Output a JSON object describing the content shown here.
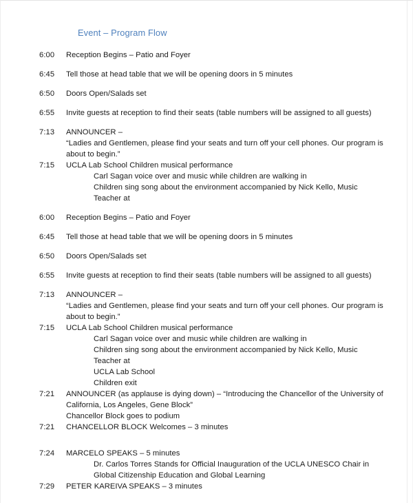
{
  "document": {
    "title": "Event – Program Flow",
    "title_color": "#4f81bd",
    "background_color": "#ffffff",
    "text_color": "#1a1a1a"
  },
  "program": {
    "rows": [
      {
        "time": "6:00",
        "text": "Reception Begins – Patio and Foyer",
        "spacing": "gap-after"
      },
      {
        "time": "6:45",
        "text": "Tell those at head table that we will be opening doors in 5 minutes",
        "spacing": "gap-after"
      },
      {
        "time": "6:50",
        "text": "Doors Open/Salads set",
        "spacing": "gap-after"
      },
      {
        "time": "6:55",
        "text": "Invite guests at reception to find their seats (table numbers will be assigned to all guests)",
        "spacing": "gap-after"
      },
      {
        "time": "7:13",
        "text": "ANNOUNCER –",
        "spacing": "tight"
      },
      {
        "time": "",
        "text": "“Ladies and Gentlemen, please find your seats and turn off your cell phones.  Our program is about to begin.”",
        "spacing": "tight"
      },
      {
        "time": "7:15",
        "text": "UCLA Lab School Children musical performance",
        "spacing": "tight"
      },
      {
        "time": "",
        "text": "Carl Sagan voice over and music while children are walking in",
        "spacing": "tight",
        "indent": true
      },
      {
        "time": "",
        "text": "Children sing song about the environment accompanied by Nick Kello, Music Teacher at",
        "spacing": "gap-after",
        "indent": true
      },
      {
        "time": "6:00",
        "text": "Reception Begins – Patio and Foyer",
        "spacing": "gap-after"
      },
      {
        "time": "6:45",
        "text": "Tell those at head table that we will be opening doors in 5 minutes",
        "spacing": "gap-after"
      },
      {
        "time": "6:50",
        "text": "Doors Open/Salads set",
        "spacing": "gap-after"
      },
      {
        "time": "6:55",
        "text": "Invite guests at reception to find their seats (table numbers will be assigned to all guests)",
        "spacing": "gap-after"
      },
      {
        "time": "7:13",
        "text": "ANNOUNCER –",
        "spacing": "tight"
      },
      {
        "time": "",
        "text": "“Ladies and Gentlemen, please find your seats and turn off your cell phones.  Our program is about to begin.”",
        "spacing": "tight"
      },
      {
        "time": "7:15",
        "text": "UCLA Lab School Children musical performance",
        "spacing": "tight"
      },
      {
        "time": "",
        "text": "Carl Sagan voice over and music while children are walking in",
        "spacing": "tight",
        "indent": true
      },
      {
        "time": "",
        "text": "Children sing song about the environment accompanied by Nick Kello, Music Teacher at",
        "spacing": "tight",
        "indent": true
      },
      {
        "time": "",
        "text": "UCLA Lab School",
        "spacing": "tight",
        "indent": true
      },
      {
        "time": "",
        "text": "Children exit",
        "spacing": "tight",
        "indent": true
      },
      {
        "time": "7:21",
        "text": "ANNOUNCER (as applause is dying down) – “Introducing the Chancellor of the University of California, Los Angeles, Gene Block”",
        "spacing": "tight"
      },
      {
        "time": "",
        "text": "Chancellor Block goes to podium",
        "spacing": "tight"
      },
      {
        "time": "7:21",
        "text": "CHANCELLOR BLOCK Welcomes – 3 minutes",
        "spacing": "gap-big"
      },
      {
        "time": "7:24",
        "text": "MARCELO SPEAKS – 5 minutes",
        "spacing": "tight"
      },
      {
        "time": "",
        "text": "Dr. Carlos Torres Stands for Official Inauguration of the UCLA UNESCO Chair in Global Citizenship Education and Global Learning",
        "spacing": "tight",
        "indent": true
      },
      {
        "time": "7:29",
        "text": "PETER KAREIVA SPEAKS – 3 minutes",
        "spacing": "tight"
      }
    ]
  }
}
